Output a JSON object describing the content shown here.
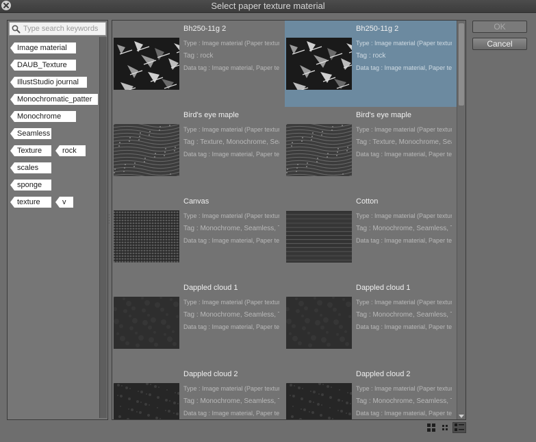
{
  "window": {
    "title": "Select paper texture material"
  },
  "search": {
    "placeholder": "Type search keywords",
    "value": ""
  },
  "tags": [
    "Image material",
    "DAUB_Texture",
    "IllustStudio journal",
    "Monochromatic_patter",
    "Monochrome",
    "Seamless",
    "Texture",
    "rock",
    "scales",
    "sponge",
    "texture",
    "v"
  ],
  "materials": [
    {
      "name": "Bh250-11g 2",
      "type": "Type : Image material (Paper texture)",
      "tag": "Tag : rock",
      "data_tag": "Data tag : Image material, Paper texture",
      "texture": "rock",
      "selected": false
    },
    {
      "name": "Bh250-11g 2",
      "type": "Type : Image material (Paper texture)",
      "tag": "Tag : rock",
      "data_tag": "Data tag : Image material, Paper texture",
      "texture": "rock",
      "selected": true
    },
    {
      "name": "Bird's eye maple",
      "type": "Type : Image material (Paper texture)",
      "tag": "Tag : Texture, Monochrome, Seamless",
      "data_tag": "Data tag : Image material, Paper texture",
      "texture": "maple",
      "selected": false
    },
    {
      "name": "Bird's eye maple",
      "type": "Type : Image material (Paper texture)",
      "tag": "Tag : Texture, Monochrome, Seamless",
      "data_tag": "Data tag : Image material, Paper texture",
      "texture": "maple",
      "selected": false
    },
    {
      "name": "Canvas",
      "type": "Type : Image material (Paper texture)",
      "tag": "Tag : Monochrome, Seamless, Texture",
      "data_tag": "Data tag : Image material, Paper texture",
      "texture": "canvas",
      "selected": false
    },
    {
      "name": "Cotton",
      "type": "Type : Image material (Paper texture)",
      "tag": "Tag : Monochrome, Seamless, Texture",
      "data_tag": "Data tag : Image material, Paper texture",
      "texture": "cotton",
      "selected": false
    },
    {
      "name": "Dappled cloud 1",
      "type": "Type : Image material (Paper texture)",
      "tag": "Tag : Monochrome, Seamless, Texture",
      "data_tag": "Data tag : Image material, Paper texture",
      "texture": "cloud",
      "selected": false
    },
    {
      "name": "Dappled cloud 1",
      "type": "Type : Image material (Paper texture)",
      "tag": "Tag : Monochrome, Seamless, Texture",
      "data_tag": "Data tag : Image material, Paper texture",
      "texture": "cloud",
      "selected": false
    },
    {
      "name": "Dappled cloud 2",
      "type": "Type : Image material (Paper texture)",
      "tag": "Tag : Monochrome, Seamless, Texture",
      "data_tag": "Data tag : Image material, Paper texture",
      "texture": "cloud2",
      "selected": false
    },
    {
      "name": "Dappled cloud 2",
      "type": "Type : Image material (Paper texture)",
      "tag": "Tag : Monochrome, Seamless, Texture",
      "data_tag": "Data tag : Image material, Paper texture",
      "texture": "cloud2",
      "selected": false
    }
  ],
  "buttons": {
    "ok_label": "OK",
    "cancel_label": "Cancel"
  },
  "view_modes": [
    "large-thumbnail-icon",
    "small-thumbnail-icon",
    "list-detail-icon"
  ],
  "colors": {
    "selection": "#6c8aa0",
    "panel": "#737373"
  }
}
